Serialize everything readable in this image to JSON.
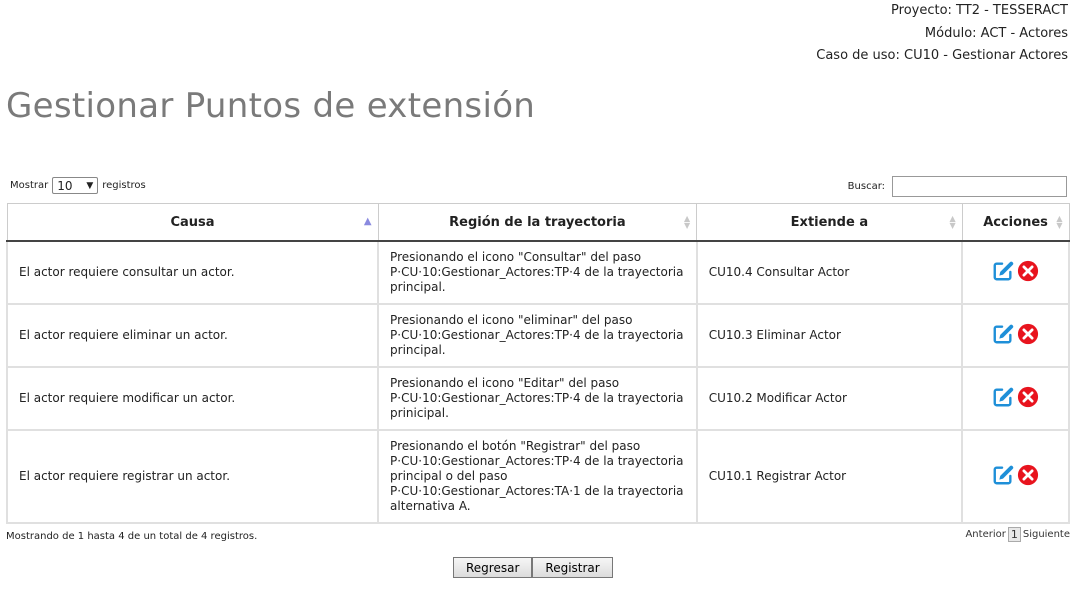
{
  "header": {
    "project": "Proyecto: TT2 - TESSERACT",
    "module": "Módulo: ACT - Actores",
    "use_case": "Caso de uso: CU10 - Gestionar Actores"
  },
  "page_title": "Gestionar Puntos de extensión",
  "controls": {
    "show_label": "Mostrar",
    "page_size": "10",
    "records_label": "registros",
    "search_label": "Buscar:",
    "search_value": ""
  },
  "table": {
    "columns": [
      "Causa",
      "Región de la trayectoria",
      "Extiende a",
      "Acciones"
    ],
    "rows": [
      {
        "cause": "El actor requiere consultar un actor.",
        "region": "Presionando el icono \"Consultar\" del paso P·CU·10:Gestionar_Actores:TP·4 de la trayectoria principal.",
        "extends": "CU10.4 Consultar Actor"
      },
      {
        "cause": "El actor requiere eliminar un actor.",
        "region": "Presionando el icono \"eliminar\" del paso P·CU·10:Gestionar_Actores:TP·4 de la trayectoria principal.",
        "extends": "CU10.3 Eliminar Actor"
      },
      {
        "cause": "El actor requiere modificar un actor.",
        "region": "Presionando el icono \"Editar\" del paso P·CU·10:Gestionar_Actores:TP·4 de la trayectoria prinicipal.",
        "extends": "CU10.2 Modificar Actor"
      },
      {
        "cause": "El actor requiere registrar un actor.",
        "region": "Presionando el botón \"Registrar\" del paso P·CU·10:Gestionar_Actores:TP·4 de la trayectoria principal o del paso P·CU·10:Gestionar_Actores:TA·1 de la trayectoria alternativa A.",
        "extends": "CU10.1 Registrar Actor"
      }
    ]
  },
  "footer": {
    "info": "Mostrando de 1 hasta 4 de un total de 4 registros.",
    "prev": "Anterior",
    "page": "1",
    "next": "Siguiente"
  },
  "buttons": {
    "back": "Regresar",
    "register": "Registrar"
  },
  "icons": {
    "edit": "edit-icon",
    "delete": "delete-icon"
  },
  "colors": {
    "title": "#7a7a7a",
    "edit_icon": "#1e8fd8",
    "delete_icon": "#e8141e",
    "sort_active": "#8a8adf"
  }
}
